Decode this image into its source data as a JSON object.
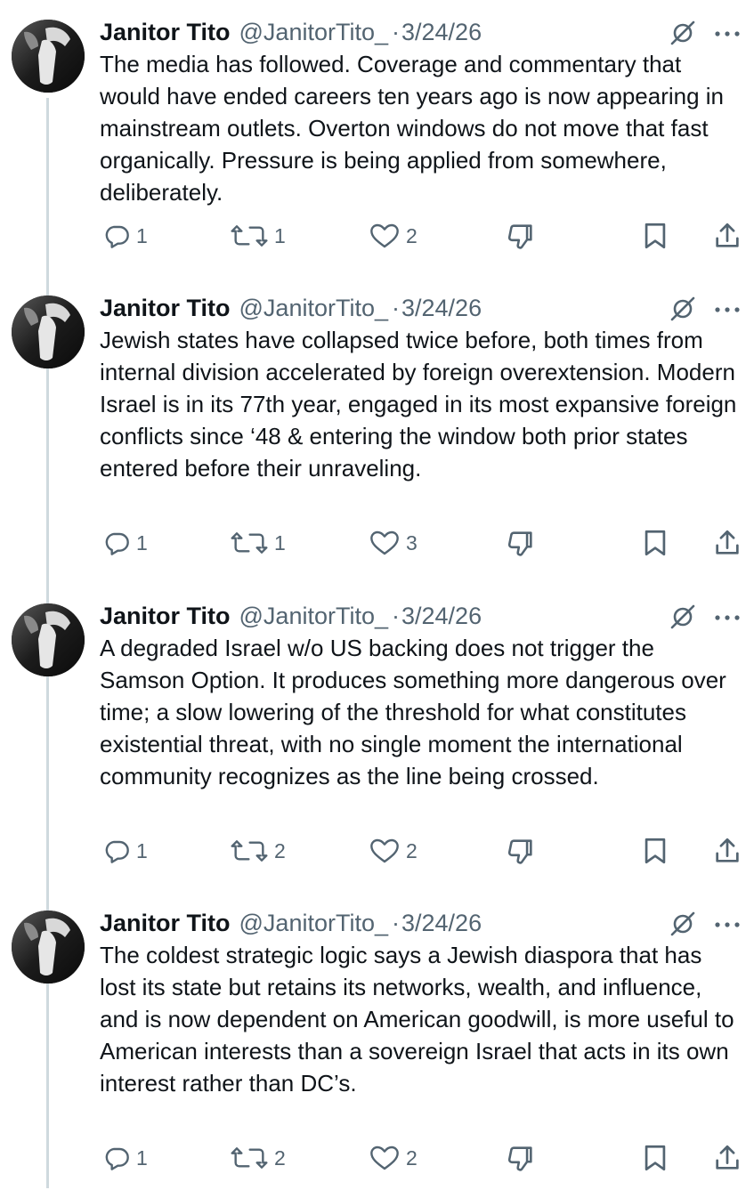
{
  "tweets": [
    {
      "name": "Janitor Tito",
      "handle": "@JanitorTito_",
      "separator": "·",
      "date": "3/24/26",
      "text": "The media has followed. Coverage and commentary that would have ended careers ten years ago is now appearing in mainstream outlets. Overton windows do not move that fast organically. Pressure is being applied from somewhere, deliberately.",
      "replies": "1",
      "reposts": "1",
      "likes": "2"
    },
    {
      "name": "Janitor Tito",
      "handle": "@JanitorTito_",
      "separator": "·",
      "date": "3/24/26",
      "text": "Jewish states have collapsed twice before, both times from internal division accelerated by foreign overextension. Modern Israel is in its 77th year, engaged in its most expansive foreign conflicts since ‘48 & entering the window both prior states entered before their unraveling.",
      "replies": "1",
      "reposts": "1",
      "likes": "3"
    },
    {
      "name": "Janitor Tito",
      "handle": "@JanitorTito_",
      "separator": "·",
      "date": "3/24/26",
      "text": "A degraded Israel w/o US backing does not trigger the Samson Option. It produces something more dangerous over time; a slow lowering of the threshold for what constitutes existential threat, with no single moment the international community recognizes as the line being crossed.",
      "replies": "1",
      "reposts": "2",
      "likes": "2"
    },
    {
      "name": "Janitor Tito",
      "handle": "@JanitorTito_",
      "separator": "·",
      "date": "3/24/26",
      "text": "The coldest strategic logic says a Jewish diaspora that has lost its state but retains its networks, wealth, and influence, and is now dependent on American goodwill, is more useful to American interests than a sovereign Israel that acts in its own interest rather than DC’s.",
      "replies": "1",
      "reposts": "2",
      "likes": "2"
    }
  ],
  "icons": {
    "reply": "reply-icon",
    "repost": "repost-icon",
    "like": "like-icon",
    "grok": "grok-icon",
    "more": "more-icon",
    "analytics": "analytics-icon",
    "bookmark": "bookmark-icon",
    "share": "share-icon"
  },
  "colors": {
    "text": "#0f1419",
    "secondary": "#536471",
    "thread_line": "#cfd9de"
  }
}
